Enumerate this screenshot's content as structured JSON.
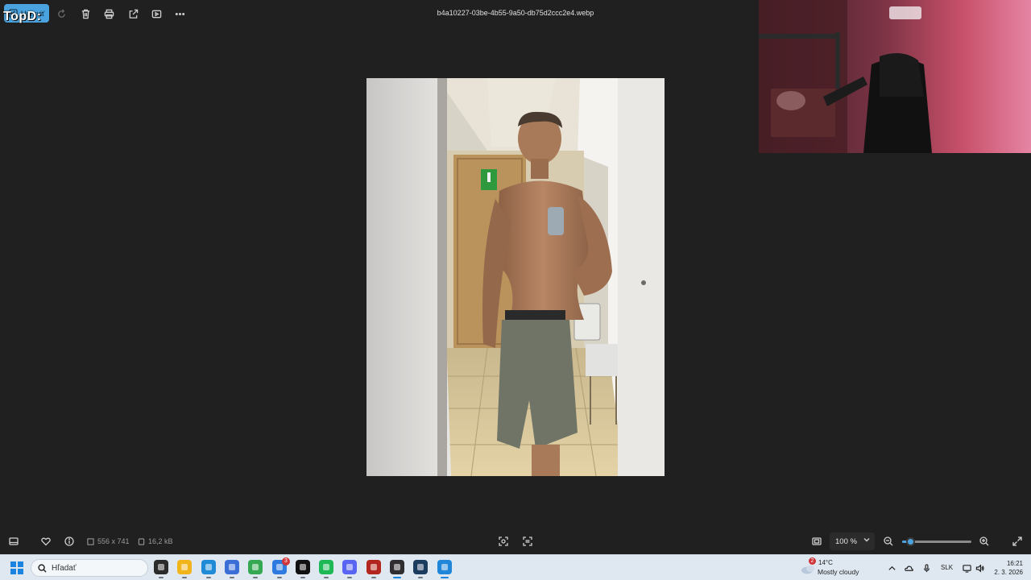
{
  "toolbar": {
    "edit_label": "Upraviť",
    "overlay_text": "TopD:",
    "file_name": "b4a10227-03be-4b55-9a50-db75d2ccc2e4.webp",
    "icons": [
      "rotate-icon",
      "delete-icon",
      "print-icon",
      "share-icon",
      "slideshow-icon",
      "more-icon"
    ]
  },
  "status_bar": {
    "dimensions": "556 x 741",
    "file_size": "16,2 kB",
    "zoom_label": "100 %",
    "zoom_level_percent": 12
  },
  "taskbar": {
    "search_placeholder": "Hľadať",
    "apps": [
      {
        "name": "task-view",
        "color": "#2b2b2b"
      },
      {
        "name": "file-explorer",
        "color": "#f2b41b"
      },
      {
        "name": "edge",
        "color": "#1f8ad6"
      },
      {
        "name": "store",
        "color": "#3a6fd8"
      },
      {
        "name": "chrome",
        "color": "#34a853"
      },
      {
        "name": "messenger",
        "color": "#2d7be0",
        "badge": "3"
      },
      {
        "name": "capcut",
        "color": "#111111"
      },
      {
        "name": "spotify",
        "color": "#1db954"
      },
      {
        "name": "discord",
        "color": "#5865f2"
      },
      {
        "name": "voicemeeter",
        "color": "#b3261e"
      },
      {
        "name": "obs",
        "color": "#302e31",
        "active": true
      },
      {
        "name": "steam",
        "color": "#1b3b5f"
      },
      {
        "name": "photos",
        "color": "#1f86d9",
        "active": true
      }
    ],
    "weather": {
      "badge": "2",
      "temp": "14°C",
      "condition": "Mostly cloudy"
    },
    "language": "SLK",
    "time": "16:21",
    "date": "2. 3. 2026"
  },
  "colors": {
    "accent": "#4aa3df",
    "background": "#202020",
    "taskbar": "#dfe8f1"
  }
}
